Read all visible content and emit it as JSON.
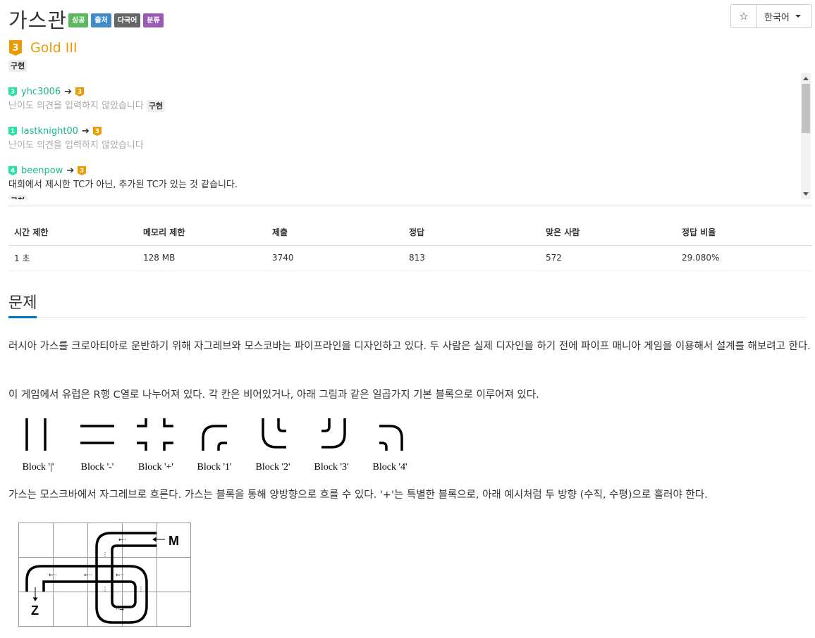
{
  "header": {
    "title": "가스관",
    "labels": [
      {
        "text": "성공",
        "color": "#5cb85c"
      },
      {
        "text": "출처",
        "color": "#428bca"
      },
      {
        "text": "다국어",
        "color": "#666666"
      },
      {
        "text": "분류",
        "color": "#9b59b6"
      }
    ],
    "star_glyph": "☆",
    "language": "한국어"
  },
  "tier": {
    "icon": "gold-3-tier-icon",
    "digit": "3",
    "name": "Gold III",
    "color": "#ec9a00"
  },
  "main_tag": "구현",
  "opinions": [
    {
      "tier_digit": "3",
      "tier_color": "#27e2a4",
      "user": "yhc3006",
      "to_digit": "3",
      "message": "난이도 의견을 입력하지 않았습니다",
      "tag": "구현"
    },
    {
      "tier_digit": "1",
      "tier_color": "#27e2a4",
      "user": "lastknight00",
      "to_digit": "3",
      "message": "난이도 의견을 입력하지 않았습니다",
      "tag": ""
    },
    {
      "tier_digit": "4",
      "tier_color": "#27e2a4",
      "user": "beenpow",
      "to_digit": "3",
      "message": "대회에서 제시한 TC가 아닌, 추가된 TC가 있는 것 같습니다.",
      "tag": "구현"
    }
  ],
  "stats": {
    "headers": [
      "시간 제한",
      "메모리 제한",
      "제출",
      "정답",
      "맞은 사람",
      "정답 비율"
    ],
    "values": [
      "1 초",
      "128 MB",
      "3740",
      "813",
      "572",
      "29.080%"
    ]
  },
  "problem": {
    "section_title": "문제",
    "para1": "러시아 가스를 크로아티아로 운반하기 위해 자그레브와 모스코바는 파이프라인을 디자인하고 있다. 두 사람은 실제 디자인을 하기 전에 파이프 매니아 게임을 이용해서 설계를 해보려고 한다.",
    "para2": "이 게임에서 유럽은 R행 C열로 나누어져 있다. 각 칸은 비어있거나, 아래 그림과 같은 일곱가지 기본 블록으로 이루어져 있다.",
    "blocks": [
      "Block '|'",
      "Block '-'",
      "Block '+'",
      "Block '1'",
      "Block '2'",
      "Block '3'",
      "Block '4'"
    ],
    "para3": "가스는 모스크바에서 자그레브로 흐른다. 가스는 블록을 통해 양방향으로 흐를 수 있다. '+'는 특별한 블록으로, 아래 예시처럼 두 방향 (수직, 수평)으로 흘러야 한다.",
    "grid_labels": {
      "moscow": "M",
      "zagreb": "Z"
    }
  }
}
